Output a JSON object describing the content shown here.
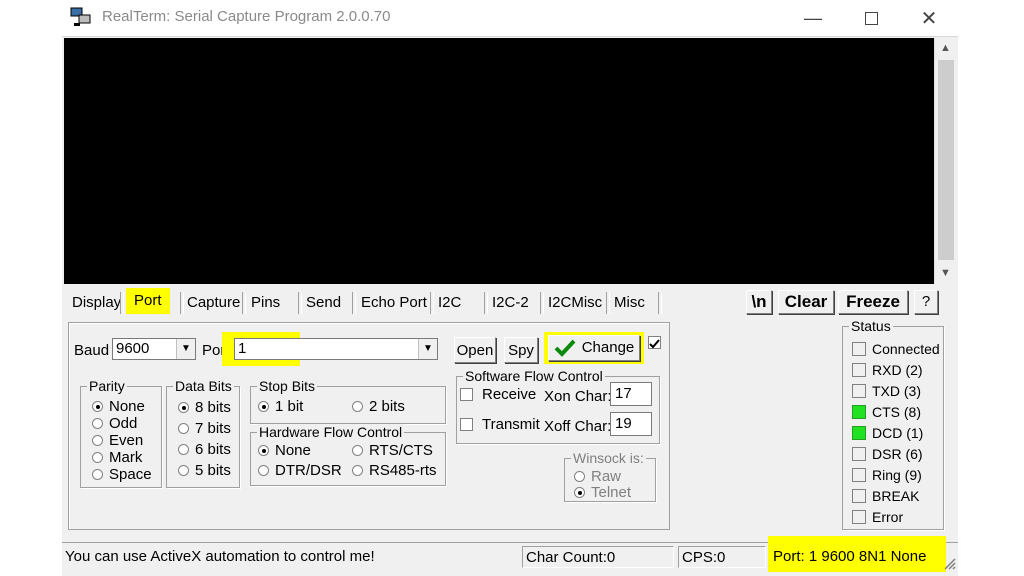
{
  "window": {
    "title": "RealTerm: Serial Capture Program 2.0.0.70"
  },
  "tabs": [
    "Display",
    "Port",
    "Capture",
    "Pins",
    "Send",
    "Echo Port",
    "I2C",
    "I2C-2",
    "I2CMisc",
    "Misc"
  ],
  "toolbar": {
    "newline_label": "\\n",
    "clear_label": "Clear",
    "freeze_label": "Freeze",
    "help_label": "?"
  },
  "port_panel": {
    "baud_label": "Baud",
    "baud_value": "9600",
    "port_label": "Port",
    "port_value": "1",
    "open_label": "Open",
    "spy_label": "Spy",
    "change_label": "Change"
  },
  "parity": {
    "title": "Parity",
    "options": [
      "None",
      "Odd",
      "Even",
      "Mark",
      "Space"
    ],
    "selected": "None"
  },
  "data_bits": {
    "title": "Data Bits",
    "options": [
      "8 bits",
      "7 bits",
      "6 bits",
      "5 bits"
    ],
    "selected": "8 bits"
  },
  "stop_bits": {
    "title": "Stop Bits",
    "options": [
      "1 bit",
      "2 bits"
    ],
    "selected": "1 bit"
  },
  "hardware_flow": {
    "title": "Hardware Flow Control",
    "options": [
      "None",
      "RTS/CTS",
      "DTR/DSR",
      "RS485-rts"
    ],
    "selected": "None"
  },
  "software_flow": {
    "title": "Software Flow Control",
    "receive_label": "Receive",
    "transmit_label": "Transmit",
    "xon_label": "Xon Char:",
    "xon_value": "17",
    "xoff_label": "Xoff Char:",
    "xoff_value": "19"
  },
  "winsock": {
    "title": "Winsock is:",
    "options": [
      "Raw",
      "Telnet"
    ],
    "selected": "Telnet"
  },
  "status": {
    "title": "Status",
    "items": [
      {
        "label": "Connected",
        "on": false
      },
      {
        "label": "RXD (2)",
        "on": false
      },
      {
        "label": "TXD (3)",
        "on": false
      },
      {
        "label": "CTS (8)",
        "on": true
      },
      {
        "label": "DCD (1)",
        "on": true
      },
      {
        "label": "DSR (6)",
        "on": false
      },
      {
        "label": "Ring (9)",
        "on": false
      },
      {
        "label": "BREAK",
        "on": false
      },
      {
        "label": "Error",
        "on": false
      }
    ],
    "on_color": "#22e022"
  },
  "statusbar": {
    "message": "You can use ActiveX automation to control me!",
    "char_count": "Char Count:0",
    "cps": "CPS:0",
    "port_info": "Port: 1 9600 8N1 None"
  },
  "colors": {
    "highlight": "#ffff00",
    "terminal_bg": "#000000"
  }
}
